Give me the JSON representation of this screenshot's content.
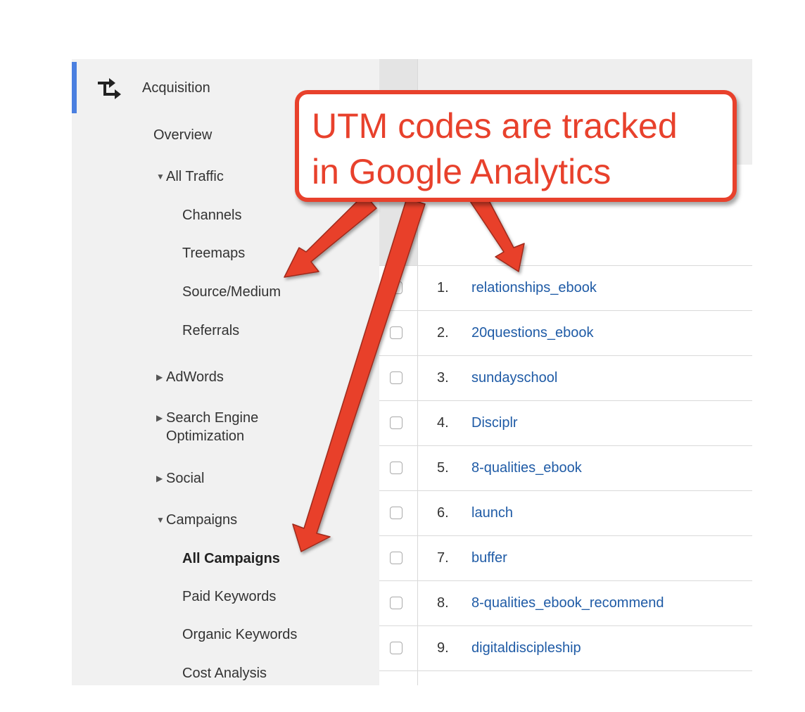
{
  "sidebar": {
    "section_title": "Acquisition",
    "section_icon": "acquisition-arrows-icon",
    "accent_color": "#4a7fe0",
    "items": [
      {
        "label": "Overview"
      },
      {
        "label": "All Traffic",
        "expanded": true
      },
      {
        "label": "Channels"
      },
      {
        "label": "Treemaps"
      },
      {
        "label": "Source/Medium"
      },
      {
        "label": "Referrals"
      },
      {
        "label": "AdWords",
        "expanded": false
      },
      {
        "label": "Search Engine",
        "label2": "Optimization",
        "expanded": false
      },
      {
        "label": "Social",
        "expanded": false
      },
      {
        "label": "Campaigns",
        "expanded": true
      },
      {
        "label": "All Campaigns",
        "active": true
      },
      {
        "label": "Paid Keywords"
      },
      {
        "label": "Organic Keywords"
      },
      {
        "label": "Cost Analysis"
      }
    ]
  },
  "table": {
    "rows": [
      {
        "num": "1.",
        "name": "relationships_ebook"
      },
      {
        "num": "2.",
        "name": "20questions_ebook"
      },
      {
        "num": "3.",
        "name": "sundayschool"
      },
      {
        "num": "4.",
        "name": "Disciplr"
      },
      {
        "num": "5.",
        "name": "8-qualities_ebook"
      },
      {
        "num": "6.",
        "name": "launch"
      },
      {
        "num": "7.",
        "name": "buffer"
      },
      {
        "num": "8.",
        "name": "8-qualities_ebook_recommend"
      },
      {
        "num": "9.",
        "name": "digitaldiscipleship"
      }
    ],
    "link_color": "#1f5ba6"
  },
  "callout": {
    "line1": "UTM codes are tracked",
    "line2": "in Google Analytics",
    "color": "#e8412c"
  }
}
